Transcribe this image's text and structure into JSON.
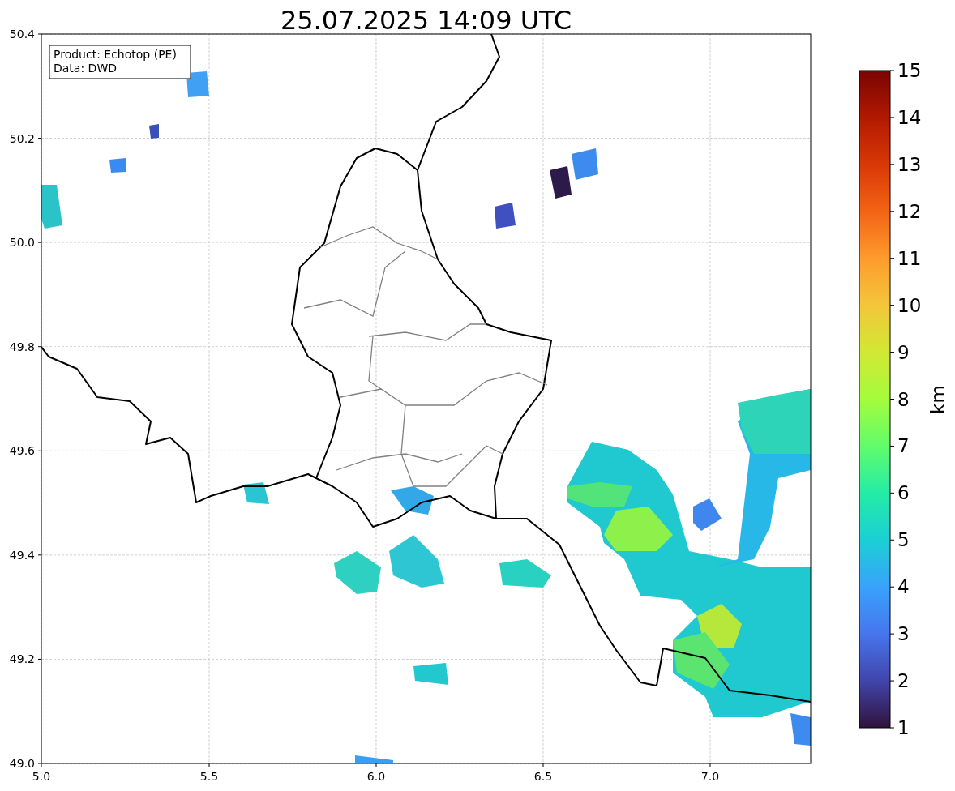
{
  "title": "25.07.2025 14:09 UTC",
  "legend": [
    "Product: Echotop (PE)",
    "Data: DWD"
  ],
  "x_ticks": [
    "5.0",
    "5.5",
    "6.0",
    "6.5",
    "7.0"
  ],
  "y_ticks": [
    "50.4",
    "50.2",
    "50.0",
    "49.8",
    "49.6",
    "49.4",
    "49.2",
    "49.0"
  ],
  "colorbar": {
    "label": "km",
    "ticks": [
      "15",
      "14",
      "13",
      "12",
      "11",
      "10",
      "9",
      "8",
      "7",
      "6",
      "5",
      "4",
      "3",
      "2",
      "1"
    ]
  }
}
